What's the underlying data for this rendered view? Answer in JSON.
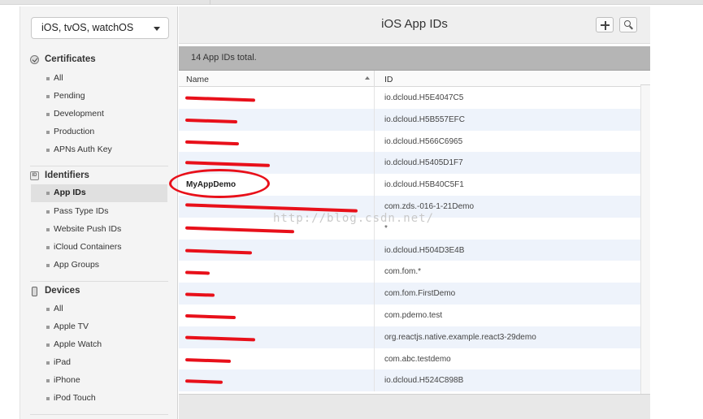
{
  "platform_selector": {
    "value": "iOS, tvOS, watchOS"
  },
  "sidebar": {
    "certificates": {
      "title": "Certificates",
      "items": [
        {
          "label": "All"
        },
        {
          "label": "Pending"
        },
        {
          "label": "Development"
        },
        {
          "label": "Production"
        },
        {
          "label": "APNs Auth Key"
        }
      ]
    },
    "identifiers": {
      "title": "Identifiers",
      "icon_text": "ID",
      "items": [
        {
          "label": "App IDs"
        },
        {
          "label": "Pass Type IDs"
        },
        {
          "label": "Website Push IDs"
        },
        {
          "label": "iCloud Containers"
        },
        {
          "label": "App Groups"
        }
      ]
    },
    "devices": {
      "title": "Devices",
      "items": [
        {
          "label": "All"
        },
        {
          "label": "Apple TV"
        },
        {
          "label": "Apple Watch"
        },
        {
          "label": "iPad"
        },
        {
          "label": "iPhone"
        },
        {
          "label": "iPod Touch"
        }
      ]
    }
  },
  "header": {
    "title": "iOS App IDs"
  },
  "summary": {
    "count_text": "14  App IDs total."
  },
  "table": {
    "columns": {
      "name": "Name",
      "id": "ID"
    },
    "rows": [
      {
        "name": "",
        "id": "io.dcloud.H5E4047C5"
      },
      {
        "name": "",
        "id": "io.dcloud.H5B557EFC"
      },
      {
        "name": "",
        "id": "io.dcloud.H566C6965"
      },
      {
        "name": "",
        "id": "io.dcloud.H5405D1F7"
      },
      {
        "name": "MyAppDemo",
        "id": "io.dcloud.H5B40C5F1"
      },
      {
        "name": "",
        "id": "com.zds.-016-1-21Demo"
      },
      {
        "name": "",
        "id": "*"
      },
      {
        "name": "",
        "id": "io.dcloud.H504D3E4B"
      },
      {
        "name": "",
        "id": "com.fom.*"
      },
      {
        "name": "",
        "id": "com.fom.FirstDemo"
      },
      {
        "name": "",
        "id": "com.pdemo.test"
      },
      {
        "name": "",
        "id": "org.reactjs.native.example.react3-29demo"
      },
      {
        "name": "",
        "id": "com.abc.testdemo"
      },
      {
        "name": "",
        "id": "io.dcloud.H524C898B"
      }
    ]
  },
  "watermark": {
    "text": "http://blog.csdn.net/"
  },
  "colors": {
    "annotation_red": "#e8101a",
    "row_alt": "#eef3fb",
    "count_bar": "#b5b5b5"
  }
}
